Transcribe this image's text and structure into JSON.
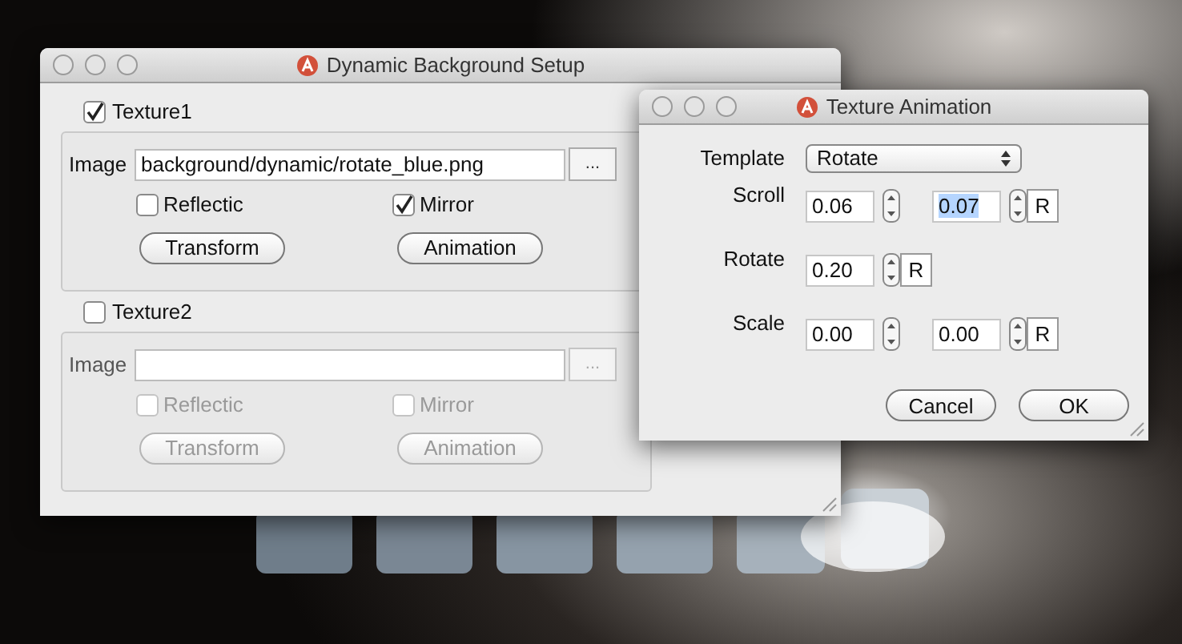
{
  "main_window": {
    "title": "Dynamic Background Setup",
    "textures": [
      {
        "label": "Texture1",
        "checked": true,
        "image_label": "Image",
        "image_value": "background/dynamic/rotate_blue.png",
        "browse": "...",
        "options": [
          {
            "label": "Reflectic",
            "checked": false
          },
          {
            "label": "Mirror",
            "checked": true
          }
        ],
        "buttons": [
          "Transform",
          "Animation"
        ]
      },
      {
        "label": "Texture2",
        "checked": false,
        "image_label": "Image",
        "browse": "...",
        "options": [
          {
            "label": "Reflectic",
            "checked": false
          },
          {
            "label": "Mirror",
            "checked": false
          }
        ],
        "buttons": [
          "Transform",
          "Animation"
        ]
      }
    ]
  },
  "animation_window": {
    "title": "Texture Animation",
    "template": {
      "label": "Template",
      "value": "Rotate"
    },
    "rows": [
      {
        "label": "Scroll",
        "fields": [
          {
            "value": "0.06",
            "selected": false
          },
          {
            "value": "0.07",
            "selected": true
          }
        ],
        "reset": "R"
      },
      {
        "label": "Rotate",
        "fields": [
          {
            "value": "0.20",
            "selected": false
          }
        ],
        "reset": "R"
      },
      {
        "label": "Scale",
        "fields": [
          {
            "value": "0.00",
            "selected": false
          },
          {
            "value": "0.00",
            "selected": false
          }
        ],
        "reset": "R"
      }
    ],
    "buttons": [
      "Cancel",
      "OK"
    ]
  }
}
